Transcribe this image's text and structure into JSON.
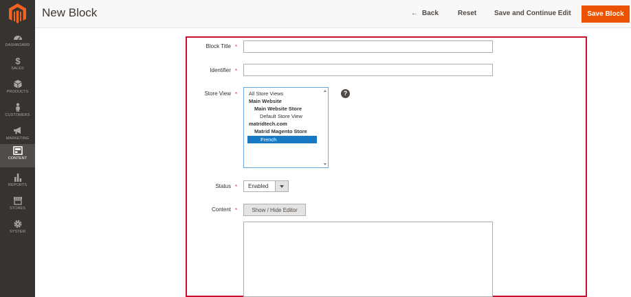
{
  "header": {
    "title": "New Block",
    "back_label": "Back",
    "reset_label": "Reset",
    "save_continue_label": "Save and Continue Edit",
    "save_label": "Save Block",
    "accent_color": "#eb5202"
  },
  "sidebar": {
    "items": [
      {
        "label": "DASHBOARD",
        "icon": "dashboard-icon"
      },
      {
        "label": "SALES",
        "icon": "dollar-icon"
      },
      {
        "label": "PRODUCTS",
        "icon": "cube-icon"
      },
      {
        "label": "CUSTOMERS",
        "icon": "person-icon"
      },
      {
        "label": "MARKETING",
        "icon": "megaphone-icon"
      },
      {
        "label": "CONTENT",
        "icon": "layout-icon",
        "active": true
      },
      {
        "label": "REPORTS",
        "icon": "bar-chart-icon"
      },
      {
        "label": "STORES",
        "icon": "store-icon"
      },
      {
        "label": "SYSTEM",
        "icon": "gear-icon"
      }
    ]
  },
  "form": {
    "block_title": {
      "label": "Block Title",
      "value": ""
    },
    "identifier": {
      "label": "Identifier",
      "value": ""
    },
    "store_view": {
      "label": "Store View",
      "options": [
        {
          "text": "All Store Views",
          "bold": false,
          "selected": false
        },
        {
          "text": "Main Website",
          "bold": true,
          "selected": false
        },
        {
          "text": "Main Website Store",
          "bold": true,
          "selected": false
        },
        {
          "text": "Default Store View",
          "bold": false,
          "selected": false
        },
        {
          "text": "matridtech.com",
          "bold": true,
          "selected": false
        },
        {
          "text": "Matrid Magento Store",
          "bold": true,
          "selected": false
        },
        {
          "text": "French",
          "bold": false,
          "selected": true
        }
      ],
      "help": "?"
    },
    "status": {
      "label": "Status",
      "value": "Enabled"
    },
    "content": {
      "label": "Content",
      "toggle_label": "Show / Hide Editor",
      "value": ""
    },
    "required_marker": "*"
  }
}
